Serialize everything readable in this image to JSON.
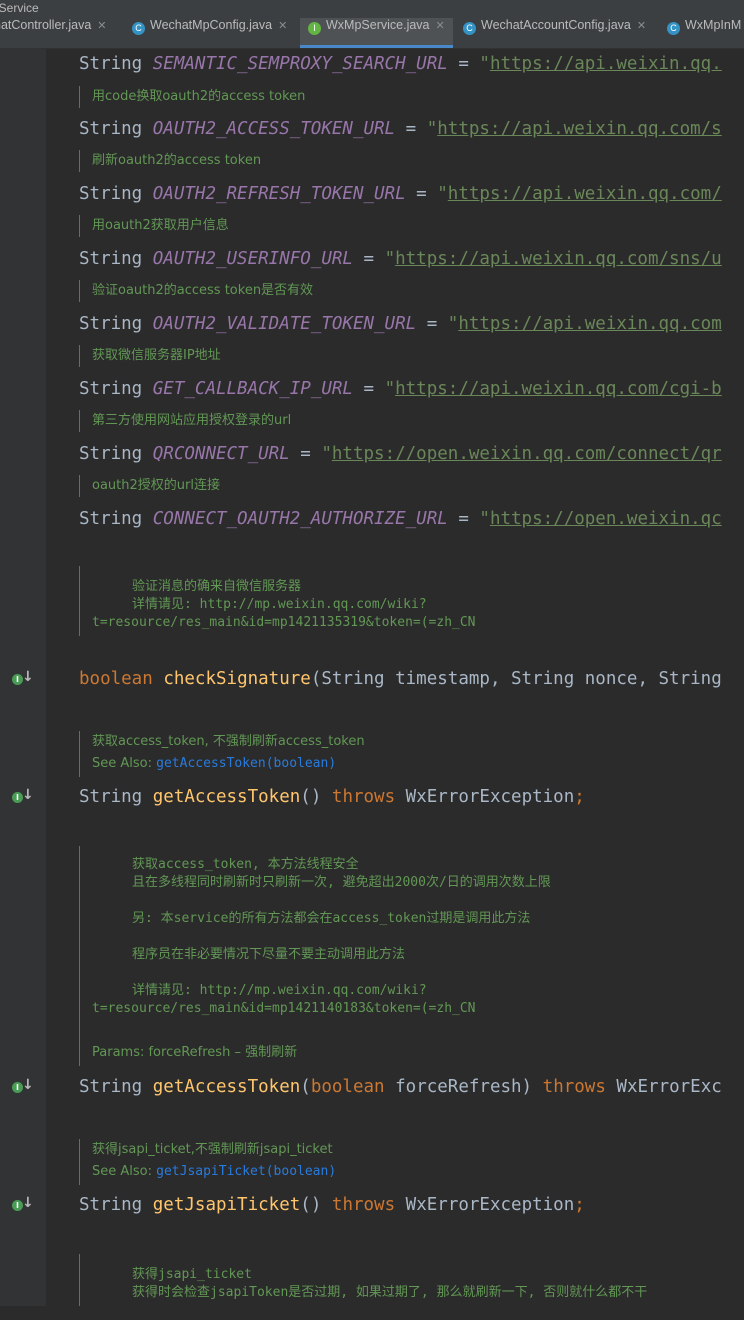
{
  "window": {
    "title": "pService"
  },
  "tabs": [
    {
      "label": "hatController.java",
      "icon": "class-icon",
      "active": false
    },
    {
      "label": "WechatMpConfig.java",
      "icon": "class-icon",
      "active": false
    },
    {
      "label": "WxMpService.java",
      "icon": "interface-icon",
      "active": true
    },
    {
      "label": "WechatAccountConfig.java",
      "icon": "class-icon",
      "active": false
    },
    {
      "label": "WxMpInM",
      "icon": "class-icon",
      "active": false
    }
  ],
  "editor": {
    "kw_string": "String",
    "kw_boolean": "boolean",
    "kw_throws": "throws",
    "exception": "WxErrorException",
    "sections": {
      "l1": {
        "name": "SEMANTIC_SEMPROXY_SEARCH_URL",
        "value": "https://api.weixin.qq."
      },
      "d2": "用code换取oauth2的access token",
      "l2": {
        "name": "OAUTH2_ACCESS_TOKEN_URL",
        "value": "https://api.weixin.qq.com/s"
      },
      "d3": "刷新oauth2的access token",
      "l3": {
        "name": "OAUTH2_REFRESH_TOKEN_URL",
        "value": "https://api.weixin.qq.com/"
      },
      "d4": "用oauth2获取用户信息",
      "l4": {
        "name": "OAUTH2_USERINFO_URL",
        "value": "https://api.weixin.qq.com/sns/u"
      },
      "d5": "验证oauth2的access token是否有效",
      "l5": {
        "name": "OAUTH2_VALIDATE_TOKEN_URL",
        "value": "https://api.weixin.qq.com"
      },
      "d6": "获取微信服务器IP地址",
      "l6": {
        "name": "GET_CALLBACK_IP_URL",
        "value": "https://api.weixin.qq.com/cgi-b"
      },
      "d7": "第三方使用网站应用授权登录的url",
      "l7": {
        "name": "QRCONNECT_URL",
        "value": "https://open.weixin.qq.com/connect/qr"
      },
      "d8": "oauth2授权的url连接",
      "l8": {
        "name": "CONNECT_OAUTH2_AUTHORIZE_URL",
        "value": "https://open.weixin.qc"
      },
      "d9": {
        "line1": "验证消息的确来自微信服务器",
        "line2": "详情请见: http://mp.weixin.qq.com/wiki?",
        "line3": "t=resource/res_main&id=mp1421135319&token=(=zh_CN"
      },
      "m1": {
        "name": "checkSignature",
        "params": "(String timestamp, String nonce, String"
      },
      "d10": {
        "line1": "获取access_token, 不强制刷新access_token",
        "see_label": "See Also:",
        "see_link": "getAccessToken(boolean)"
      },
      "m2": {
        "name": "getAccessToken",
        "params": "()"
      },
      "d11": {
        "line1": "获取access_token, 本方法线程安全",
        "line2": "且在多线程同时刷新时只刷新一次, 避免超出2000次/日的调用次数上限",
        "line3": "另: 本service的所有方法都会在access_token过期是调用此方法",
        "line4": "程序员在非必要情况下尽量不要主动调用此方法",
        "line5": "详情请见: http://mp.weixin.qq.com/wiki?",
        "line6": "t=resource/res_main&id=mp1421140183&token=(=zh_CN",
        "params": "Params: forceRefresh – 强制刷新"
      },
      "m3": {
        "name": "getAccessToken",
        "params_open": "(",
        "param_type": "boolean",
        "param_name": " forceRefresh)",
        "exception": "WxErrorExc"
      },
      "d12": {
        "line1": "获得jsapi_ticket,不强制刷新jsapi_ticket",
        "see_label": "See Also:",
        "see_link": "getJsapiTicket(boolean)"
      },
      "m4": {
        "name": "getJsapiTicket",
        "params": "()"
      },
      "d13": {
        "line1": "获得jsapi_ticket",
        "line2": "获得时会检查jsapiToken是否过期, 如果过期了, 那么就刷新一下, 否则就什么都不干"
      }
    }
  }
}
